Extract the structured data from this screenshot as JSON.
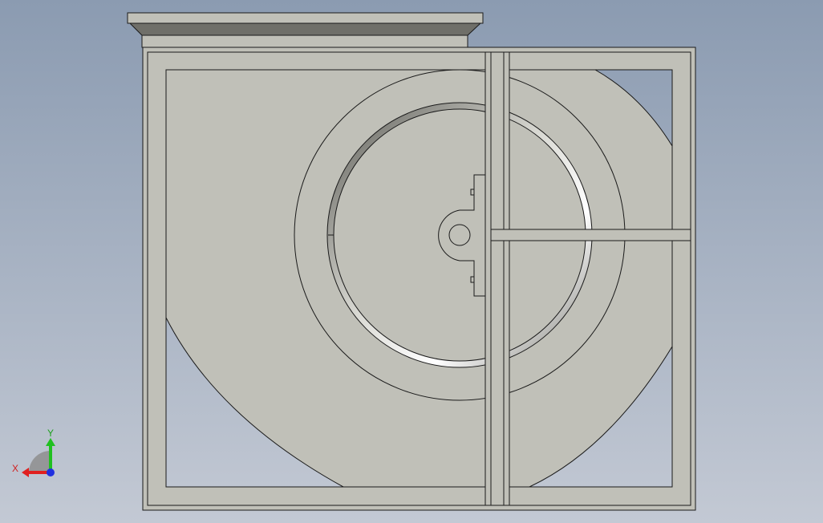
{
  "viewport": {
    "background_top": "#8b9bb1",
    "background_bottom": "#c3c9d4"
  },
  "model": {
    "part_fill": "#c0c0b8",
    "part_stroke": "#1a1a1a",
    "hole_fill": "#9aa8bb",
    "highlight_color": "#ffffff",
    "shadow_color": "#6e6e68"
  },
  "triad": {
    "x_label": "X",
    "y_label": "Y",
    "x_color": "#e02020",
    "y_color": "#20c020",
    "z_color": "#2030e0"
  }
}
